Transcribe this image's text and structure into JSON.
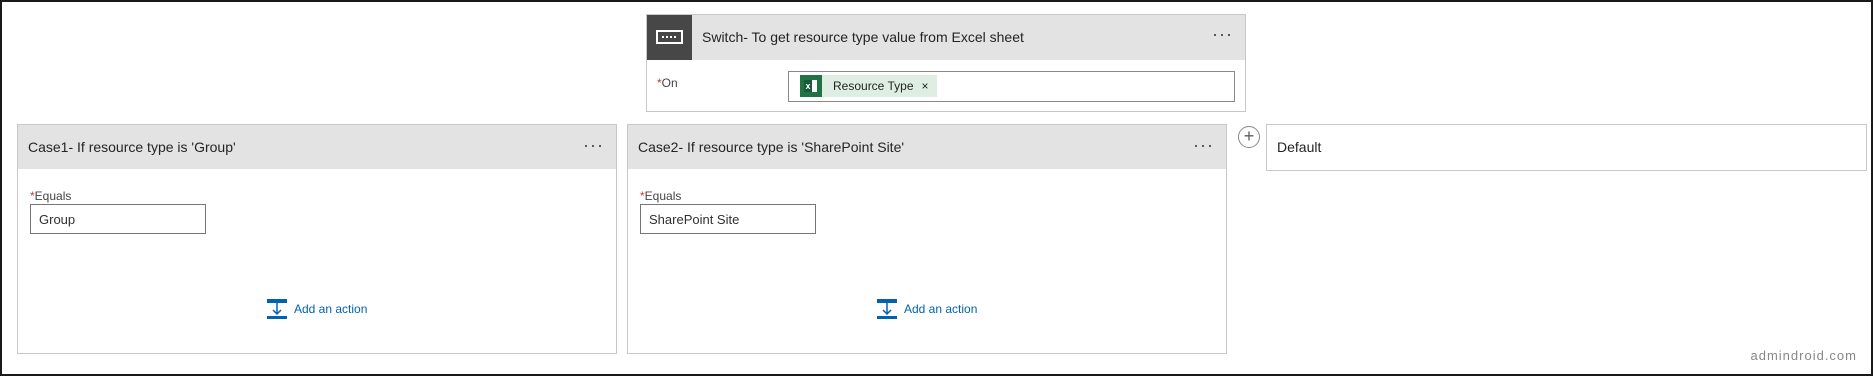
{
  "switch": {
    "title": "Switch- To get resource type value from Excel sheet",
    "menu": "···",
    "on_required": "*",
    "on_label": "On",
    "token_label": "Resource Type",
    "token_close": "×",
    "icon": "switch-icon",
    "token_icon": "excel-icon"
  },
  "cases": [
    {
      "title": "Case1- If resource type is 'Group'",
      "menu": "···",
      "equals_required": "*",
      "equals_label": "Equals",
      "equals_value": "Group",
      "add_action_label": "Add an action"
    },
    {
      "title": "Case2- If resource type is 'SharePoint Site'",
      "menu": "···",
      "equals_required": "*",
      "equals_label": "Equals",
      "equals_value": "SharePoint Site",
      "add_action_label": "Add an action"
    }
  ],
  "add_case": {
    "symbol": "+"
  },
  "default_case": {
    "title": "Default"
  },
  "watermark": "admindroid.com",
  "colors": {
    "header_bg": "#e3e3e3",
    "switch_icon_bg": "#474747",
    "excel_green": "#217346",
    "token_bg": "#dfeee3",
    "link_blue": "#0062b1",
    "required_red": "#d13438"
  }
}
